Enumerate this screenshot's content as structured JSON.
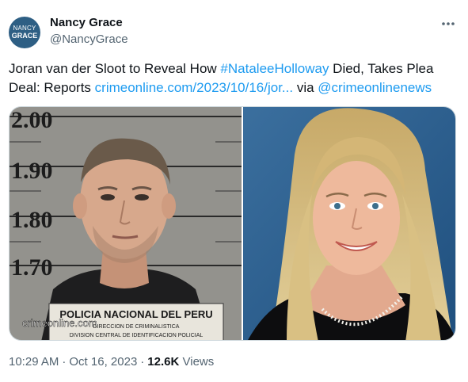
{
  "author": {
    "name": "Nancy Grace",
    "handle": "@NancyGrace",
    "avatar_line1": "NANCY",
    "avatar_line2": "GRACE",
    "avatar_color": "#2e5f84"
  },
  "more_icon": "ellipsis-horizontal-icon",
  "tweet": {
    "text_1": "Joran van der Sloot to Reveal How ",
    "hashtag": "#NataleeHolloway",
    "text_2": " Died, Takes Plea Deal: Reports ",
    "link": "crimeonline.com/2023/10/16/jor...",
    "text_3": " via ",
    "mention": "@crimeonlinenews",
    "link_color": "#1d9bf0"
  },
  "media": {
    "watermark": "crimeonline.com",
    "height_marks": [
      "2.00",
      "1.90",
      "1.80",
      "1.70"
    ],
    "placard_line1": "POLICIA NACIONAL DEL PERU",
    "placard_line2": "DIRECCION DE CRIMINALISTICA",
    "placard_line3": "DIVISION CENTRAL DE IDENTIFICACION POLICIAL"
  },
  "meta": {
    "time": "10:29 AM",
    "separator": "·",
    "date": "Oct 16, 2023",
    "views_count": "12.6K",
    "views_label": "Views"
  }
}
